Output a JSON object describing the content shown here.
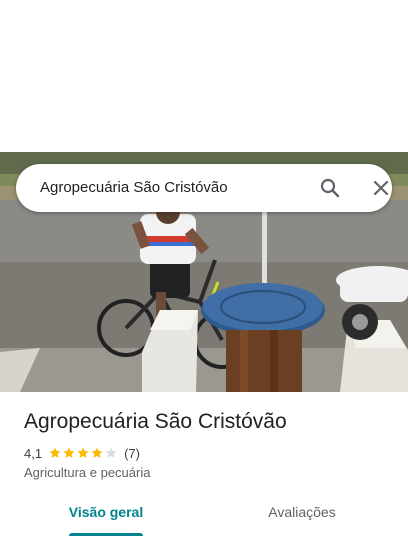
{
  "search": {
    "query": "Agropecuária São Cristóvão"
  },
  "place": {
    "name": "Agropecuária São Cristóvão",
    "rating": "4,1",
    "stars_filled": 4,
    "stars_total": 5,
    "review_count": "(7)",
    "category": "Agricultura e pecuária"
  },
  "tabs": [
    {
      "label": "Visão geral",
      "active": true
    },
    {
      "label": "Avaliações",
      "active": false
    }
  ],
  "colors": {
    "accent": "#00838f",
    "star_filled": "#fbbc04",
    "star_empty": "#dadce0"
  },
  "icons": {
    "search": "search-icon",
    "close": "close-icon",
    "star": "star-icon"
  }
}
